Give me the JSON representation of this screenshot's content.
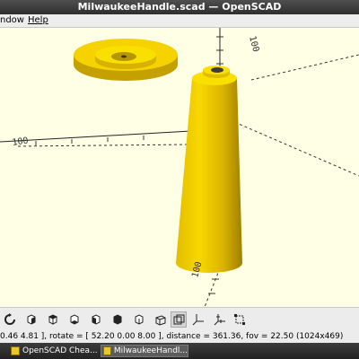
{
  "window": {
    "title": "MilwaukeeHandle.scad — OpenSCAD"
  },
  "menu": {
    "items": [
      "ndow",
      "Help"
    ]
  },
  "viewport": {
    "axis_labels": [
      "100",
      "100",
      "100"
    ]
  },
  "toolbar": {
    "buttons": [
      {
        "icon": "reset-view-icon"
      },
      {
        "icon": "view-right-icon"
      },
      {
        "icon": "view-top-icon"
      },
      {
        "icon": "view-bottom-icon"
      },
      {
        "icon": "view-left-icon"
      },
      {
        "icon": "view-front-icon"
      },
      {
        "icon": "view-back-icon"
      },
      {
        "icon": "perspective-icon"
      },
      {
        "icon": "orthogonal-icon",
        "active": true
      },
      {
        "icon": "show-axes-icon"
      },
      {
        "icon": "show-scale-markers-icon"
      },
      {
        "icon": "show-edges-icon"
      }
    ]
  },
  "status": {
    "text": "0.46 4.81 ], rotate = [ 52.20 0.00 8.00 ], distance = 361.36, fov = 22.50 (1024x469)"
  },
  "taskbar": {
    "items": [
      {
        "label": "OpenSCAD Chea..."
      },
      {
        "label": "MilwaukeeHandl..."
      }
    ]
  },
  "colors": {
    "model": "#f5d000",
    "model_shade": "#c9a300",
    "background": "#ffffe5"
  }
}
